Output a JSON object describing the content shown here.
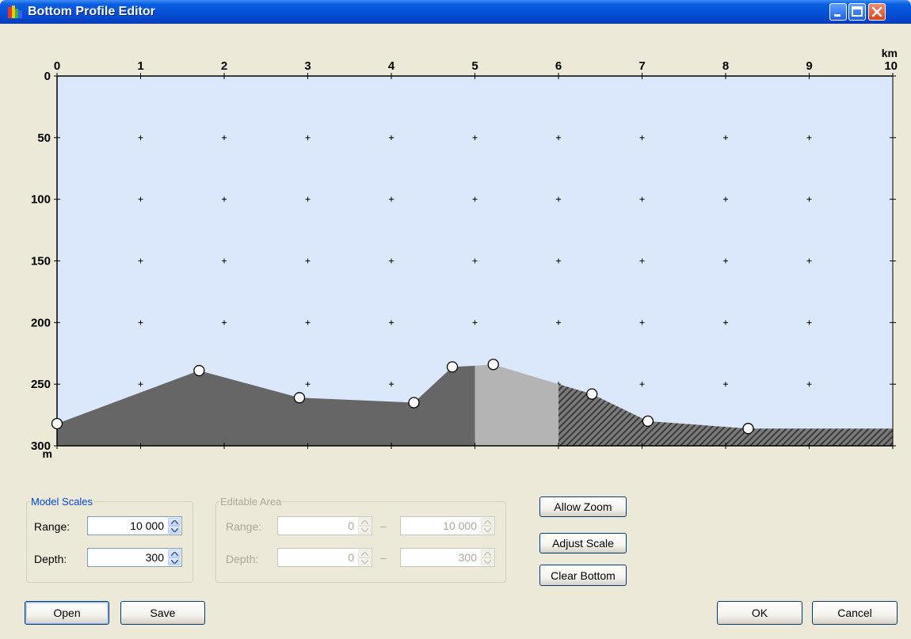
{
  "window": {
    "title": "Bottom Profile Editor"
  },
  "colors": {
    "water": "#dbe8fb",
    "bottom_dark": "#666666",
    "bottom_light": "#b4b4b4",
    "hatch": "#4a4a4a",
    "point_fill": "#ffffff"
  },
  "icons": {
    "app": "app-icon",
    "minimize": "minimize-icon",
    "maximize": "maximize-icon",
    "close": "close-icon"
  },
  "chart_data": {
    "type": "area",
    "x_unit": "km",
    "y_unit": "m",
    "xlim": [
      0,
      10
    ],
    "ylim": [
      0,
      300
    ],
    "y_inverted": true,
    "x_ticks": [
      "0",
      "1",
      "2",
      "3",
      "4",
      "5",
      "6",
      "7",
      "8",
      "9",
      "10"
    ],
    "y_ticks": [
      "0",
      "50",
      "100",
      "150",
      "200",
      "250",
      "300"
    ],
    "grid": "plus-markers",
    "bottom_profile": [
      {
        "x": 0.0,
        "y": 282
      },
      {
        "x": 1.7,
        "y": 239
      },
      {
        "x": 2.9,
        "y": 261
      },
      {
        "x": 4.27,
        "y": 265
      },
      {
        "x": 4.73,
        "y": 236
      },
      {
        "x": 5.0,
        "y": 235
      },
      {
        "x": 5.22,
        "y": 234
      },
      {
        "x": 6.0,
        "y": 250
      },
      {
        "x": 6.4,
        "y": 258
      },
      {
        "x": 7.07,
        "y": 280
      },
      {
        "x": 8.27,
        "y": 286
      },
      {
        "x": 10.0,
        "y": 286
      }
    ],
    "control_points": [
      {
        "x": 0.0,
        "y": 282
      },
      {
        "x": 1.7,
        "y": 239
      },
      {
        "x": 2.9,
        "y": 261
      },
      {
        "x": 4.27,
        "y": 265
      },
      {
        "x": 4.73,
        "y": 236
      },
      {
        "x": 5.22,
        "y": 234
      },
      {
        "x": 6.4,
        "y": 258
      },
      {
        "x": 7.07,
        "y": 280
      },
      {
        "x": 8.27,
        "y": 286
      }
    ],
    "sections": [
      {
        "from": 0,
        "to": 5,
        "style": "solid-dark"
      },
      {
        "from": 5,
        "to": 6,
        "style": "solid-light"
      },
      {
        "from": 6,
        "to": 10,
        "style": "hatched"
      }
    ]
  },
  "model_scales": {
    "legend": "Model Scales",
    "range_label": "Range:",
    "range_value": "10 000",
    "depth_label": "Depth:",
    "depth_value": "300"
  },
  "editable_area": {
    "legend": "Editable Area",
    "range_label": "Range:",
    "range_from": "0",
    "range_to": "10 000",
    "depth_label": "Depth:",
    "depth_from": "0",
    "depth_to": "300",
    "separator": "–"
  },
  "buttons": {
    "allow_zoom": "Allow Zoom",
    "adjust_scale": "Adjust Scale",
    "clear_bottom": "Clear Bottom",
    "open": "Open",
    "save": "Save",
    "ok": "OK",
    "cancel": "Cancel"
  }
}
